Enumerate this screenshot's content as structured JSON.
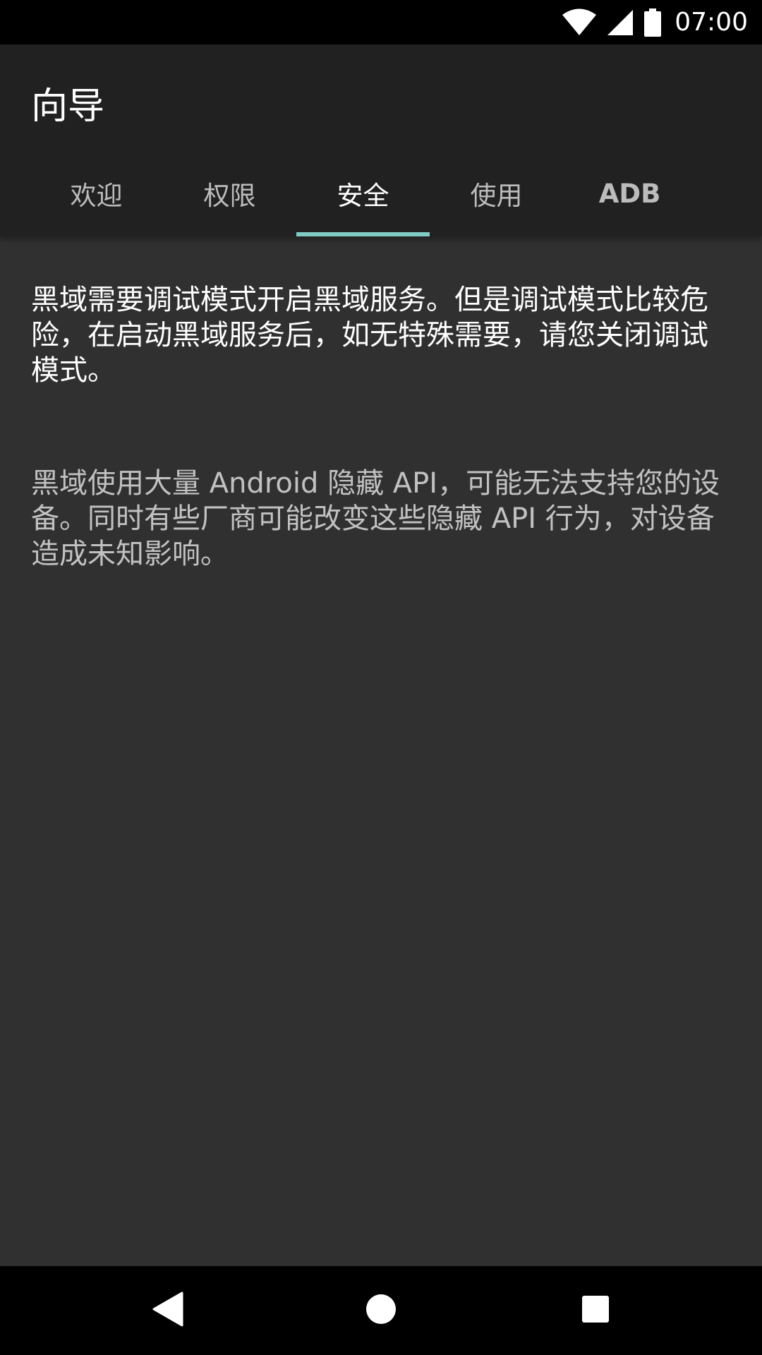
{
  "status_bar": {
    "time": "07:00",
    "icons": [
      "wifi-icon",
      "cell-signal-icon",
      "battery-icon"
    ]
  },
  "app_bar": {
    "title": "向导",
    "tabs": [
      {
        "label": "欢迎",
        "active": false
      },
      {
        "label": "权限",
        "active": false
      },
      {
        "label": "安全",
        "active": true
      },
      {
        "label": "使用",
        "active": false
      },
      {
        "label": "ADB",
        "active": false
      }
    ]
  },
  "content": {
    "paragraph_1": "黑域需要调试模式开启黑域服务。但是调试模式比较危险，在启动黑域服务后，如无特殊需要，请您关闭调试模式。",
    "paragraph_2": "黑域使用大量 Android 隐藏 API，可能无法支持您的设备。同时有些厂商可能改变这些隐藏 API 行为，对设备造成未知影响。"
  },
  "nav_bar": {
    "icons": [
      "back-icon",
      "home-icon",
      "recents-icon"
    ]
  },
  "colors": {
    "status_bar": "#000000",
    "app_bar": "#212121",
    "background": "#303030",
    "accent": "#80CBC4"
  }
}
